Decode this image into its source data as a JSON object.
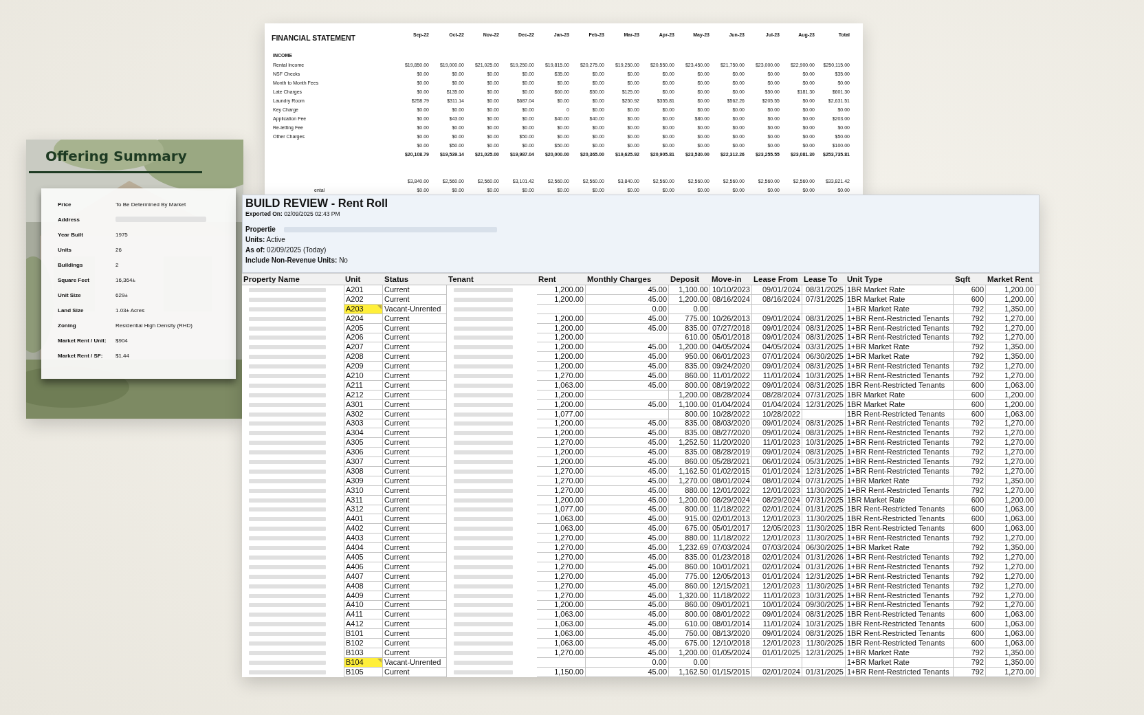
{
  "financial_statement": {
    "title": "FINANCIAL STATEMENT",
    "columns": [
      "Sep-22",
      "Oct-22",
      "Nov-22",
      "Dec-22",
      "Jan-23",
      "Feb-23",
      "Mar-23",
      "Apr-23",
      "May-23",
      "Jun-23",
      "Jul-23",
      "Aug-23",
      "Total"
    ],
    "rows": [
      {
        "kind": "section",
        "label": "INCOME"
      },
      {
        "kind": "item",
        "label": "Rental Income",
        "values": [
          "$19,850.00",
          "$19,000.00",
          "$21,025.00",
          "$19,250.00",
          "$19,815.00",
          "$20,275.00",
          "$19,250.00",
          "$20,550.00",
          "$23,450.00",
          "$21,750.00",
          "$23,000.00",
          "$22,900.00",
          "$250,115.00"
        ]
      },
      {
        "kind": "item",
        "label": "NSF Checks",
        "values": [
          "$0.00",
          "$0.00",
          "$0.00",
          "$0.00",
          "$35.00",
          "$0.00",
          "$0.00",
          "$0.00",
          "$0.00",
          "$0.00",
          "$0.00",
          "$0.00",
          "$35.00"
        ]
      },
      {
        "kind": "item",
        "label": "Month to Month Fees",
        "values": [
          "$0.00",
          "$0.00",
          "$0.00",
          "$0.00",
          "$0.00",
          "$0.00",
          "$0.00",
          "$0.00",
          "$0.00",
          "$0.00",
          "$0.00",
          "$0.00",
          "$0.00"
        ]
      },
      {
        "kind": "item",
        "label": "Late Charges",
        "values": [
          "$0.00",
          "$135.00",
          "$0.00",
          "$0.00",
          "$60.00",
          "$50.00",
          "$125.00",
          "$0.00",
          "$0.00",
          "$0.00",
          "$50.00",
          "$181.30",
          "$601.30"
        ]
      },
      {
        "kind": "item",
        "label": "Laundry Room",
        "values": [
          "$258.79",
          "$311.14",
          "$0.00",
          "$687.04",
          "$0.00",
          "$0.00",
          "$250.92",
          "$355.81",
          "$0.00",
          "$562.26",
          "$205.55",
          "$0.00",
          "$2,631.51"
        ]
      },
      {
        "kind": "item",
        "label": "Key Charge",
        "values": [
          "$0.00",
          "$0.00",
          "$0.00",
          "$0.00",
          "0",
          "$0.00",
          "$0.00",
          "$0.00",
          "$0.00",
          "$0.00",
          "$0.00",
          "$0.00",
          "$0.00"
        ]
      },
      {
        "kind": "item",
        "label": "Application Fee",
        "values": [
          "$0.00",
          "$43.00",
          "$0.00",
          "$0.00",
          "$40.00",
          "$40.00",
          "$0.00",
          "$0.00",
          "$80.00",
          "$0.00",
          "$0.00",
          "$0.00",
          "$203.00"
        ]
      },
      {
        "kind": "item",
        "label": "Re-letting Fee",
        "values": [
          "$0.00",
          "$0.00",
          "$0.00",
          "$0.00",
          "$0.00",
          "$0.00",
          "$0.00",
          "$0.00",
          "$0.00",
          "$0.00",
          "$0.00",
          "$0.00",
          "$0.00"
        ]
      },
      {
        "kind": "item",
        "label": "Other Charges",
        "values": [
          "$0.00",
          "$0.00",
          "$0.00",
          "$50.00",
          "$0.00",
          "$0.00",
          "$0.00",
          "$0.00",
          "$0.00",
          "$0.00",
          "$0.00",
          "$0.00",
          "$50.00"
        ]
      },
      {
        "kind": "item",
        "values": [
          "$0.00",
          "$50.00",
          "$0.00",
          "$0.00",
          "$50.00",
          "$0.00",
          "$0.00",
          "$0.00",
          "$0.00",
          "$0.00",
          "$0.00",
          "$0.00",
          "$100.00"
        ]
      },
      {
        "kind": "total",
        "values": [
          "$20,108.79",
          "$19,539.14",
          "$21,025.00",
          "$19,987.04",
          "$20,000.00",
          "$20,365.00",
          "$19,625.92",
          "$20,905.81",
          "$23,530.00",
          "$22,312.26",
          "$23,255.55",
          "$23,081.30",
          "$253,735.81"
        ]
      },
      {
        "kind": "spacer"
      },
      {
        "kind": "item",
        "values": [
          "$3,840.00",
          "$2,560.00",
          "$2,560.00",
          "$3,101.42",
          "$2,560.00",
          "$2,560.00",
          "$3,840.00",
          "$2,560.00",
          "$2,560.00",
          "$2,560.00",
          "$2,560.00",
          "$2,560.00",
          "$33,821.42"
        ]
      },
      {
        "kind": "item",
        "label": "ental",
        "label_cut": true,
        "values": [
          "$0.00",
          "$0.00",
          "$0.00",
          "$0.00",
          "$0.00",
          "$0.00",
          "$0.00",
          "$0.00",
          "$0.00",
          "$0.00",
          "$0.00",
          "$0.00",
          "$0.00"
        ]
      }
    ]
  },
  "offering_summary": {
    "title": "Offering Summary",
    "fields": [
      {
        "label": "Price",
        "value": "To Be Determined By Market"
      },
      {
        "label": "Address"
      },
      {
        "label": "Year Built",
        "value": "1975"
      },
      {
        "label": "Units",
        "value": "26"
      },
      {
        "label": "Buildings",
        "value": "2"
      },
      {
        "label": "Square Feet",
        "value": "16,364±"
      },
      {
        "label": "Unit Size",
        "value": "629±"
      },
      {
        "label": "Land Size",
        "value": "1.03± Acres"
      },
      {
        "label": "Zoning",
        "value": "Residential High Density (RHD)"
      },
      {
        "label": "Market Rent / Unit:",
        "value": "$904"
      },
      {
        "label": "Market Rent / SF:",
        "value": "$1.44"
      }
    ]
  },
  "rent_roll": {
    "title": "BUILD REVIEW - Rent Roll",
    "exported": "**Exported On:** 02/09/2025 02:43 PM",
    "property_label": "Propertie",
    "filters": [
      "**Units:** Active",
      "**As of:** 02/09/2025 (Today)",
      "**Include Non-Revenue Units:** No"
    ],
    "columns": [
      {
        "label": "Property Name",
        "kind": "redacted"
      },
      {
        "label": "Unit",
        "kind": "unit"
      },
      {
        "label": "Status",
        "kind": "text"
      },
      {
        "label": "Tenant",
        "kind": "redacted"
      },
      {
        "label": "Rent",
        "kind": "number"
      },
      {
        "label": "Monthly Charges",
        "kind": "number"
      },
      {
        "label": "Deposit",
        "kind": "number"
      },
      {
        "label": "Move-in",
        "kind": "number"
      },
      {
        "label": "Lease From",
        "kind": "number"
      },
      {
        "label": "Lease To",
        "kind": "number"
      },
      {
        "label": "Unit Type",
        "kind": "text"
      },
      {
        "label": "Sqft",
        "kind": "number"
      },
      {
        "label": "Market Rent",
        "kind": "number"
      }
    ],
    "rows": [
      {
        "highlighted": false,
        "cells": [
          null,
          "A201",
          "Current",
          null,
          "1,200.00",
          "45.00",
          "1,100.00",
          "10/10/2023",
          "09/01/2024",
          "08/31/2025",
          "1BR Market Rate",
          "600",
          "1,200.00"
        ]
      },
      {
        "highlighted": false,
        "cells": [
          null,
          "A202",
          "Current",
          null,
          "1,200.00",
          "45.00",
          "1,200.00",
          "08/16/2024",
          "08/16/2024",
          "07/31/2025",
          "1BR Market Rate",
          "600",
          "1,200.00"
        ]
      },
      {
        "highlighted": true,
        "cells": [
          null,
          "A203",
          "Vacant-Unrented",
          null,
          null,
          "0.00",
          "0.00",
          null,
          null,
          null,
          "1+BR Market Rate",
          "792",
          "1,350.00"
        ]
      },
      {
        "highlighted": false,
        "cells": [
          null,
          "A204",
          "Current",
          null,
          "1,200.00",
          "45.00",
          "775.00",
          "10/26/2013",
          "09/01/2024",
          "08/31/2025",
          "1+BR Rent-Restricted Tenants",
          "792",
          "1,270.00"
        ]
      },
      {
        "highlighted": false,
        "cells": [
          null,
          "A205",
          "Current",
          null,
          "1,200.00",
          "45.00",
          "835.00",
          "07/27/2018",
          "09/01/2024",
          "08/31/2025",
          "1+BR Rent-Restricted Tenants",
          "792",
          "1,270.00"
        ]
      },
      {
        "highlighted": false,
        "cells": [
          null,
          "A206",
          "Current",
          null,
          "1,200.00",
          null,
          "610.00",
          "05/01/2018",
          "09/01/2024",
          "08/31/2025",
          "1+BR Rent-Restricted Tenants",
          "792",
          "1,270.00"
        ]
      },
      {
        "highlighted": false,
        "cells": [
          null,
          "A207",
          "Current",
          null,
          "1,200.00",
          "45.00",
          "1,200.00",
          "04/05/2024",
          "04/05/2024",
          "03/31/2025",
          "1+BR Market Rate",
          "792",
          "1,350.00"
        ]
      },
      {
        "highlighted": false,
        "cells": [
          null,
          "A208",
          "Current",
          null,
          "1,200.00",
          "45.00",
          "950.00",
          "06/01/2023",
          "07/01/2024",
          "06/30/2025",
          "1+BR Market Rate",
          "792",
          "1,350.00"
        ]
      },
      {
        "highlighted": false,
        "cells": [
          null,
          "A209",
          "Current",
          null,
          "1,200.00",
          "45.00",
          "835.00",
          "09/24/2020",
          "09/01/2024",
          "08/31/2025",
          "1+BR Rent-Restricted Tenants",
          "792",
          "1,270.00"
        ]
      },
      {
        "highlighted": false,
        "cells": [
          null,
          "A210",
          "Current",
          null,
          "1,270.00",
          "45.00",
          "860.00",
          "11/01/2022",
          "11/01/2024",
          "10/31/2025",
          "1+BR Rent-Restricted Tenants",
          "792",
          "1,270.00"
        ]
      },
      {
        "highlighted": false,
        "cells": [
          null,
          "A211",
          "Current",
          null,
          "1,063.00",
          "45.00",
          "800.00",
          "08/19/2022",
          "09/01/2024",
          "08/31/2025",
          "1BR Rent-Restricted Tenants",
          "600",
          "1,063.00"
        ]
      },
      {
        "highlighted": false,
        "cells": [
          null,
          "A212",
          "Current",
          null,
          "1,200.00",
          null,
          "1,200.00",
          "08/28/2024",
          "08/28/2024",
          "07/31/2025",
          "1BR Market Rate",
          "600",
          "1,200.00"
        ]
      },
      {
        "highlighted": false,
        "cells": [
          null,
          "A301",
          "Current",
          null,
          "1,200.00",
          "45.00",
          "1,100.00",
          "01/04/2024",
          "01/04/2024",
          "12/31/2025",
          "1BR Market Rate",
          "600",
          "1,200.00"
        ]
      },
      {
        "highlighted": false,
        "cells": [
          null,
          "A302",
          "Current",
          null,
          "1,077.00",
          null,
          "800.00",
          "10/28/2022",
          "10/28/2022",
          null,
          "1BR Rent-Restricted Tenants",
          "600",
          "1,063.00"
        ]
      },
      {
        "highlighted": false,
        "cells": [
          null,
          "A303",
          "Current",
          null,
          "1,200.00",
          "45.00",
          "835.00",
          "08/03/2020",
          "09/01/2024",
          "08/31/2025",
          "1+BR Rent-Restricted Tenants",
          "792",
          "1,270.00"
        ]
      },
      {
        "highlighted": false,
        "cells": [
          null,
          "A304",
          "Current",
          null,
          "1,200.00",
          "45.00",
          "835.00",
          "08/27/2020",
          "09/01/2024",
          "08/31/2025",
          "1+BR Rent-Restricted Tenants",
          "792",
          "1,270.00"
        ]
      },
      {
        "highlighted": false,
        "cells": [
          null,
          "A305",
          "Current",
          null,
          "1,270.00",
          "45.00",
          "1,252.50",
          "11/20/2020",
          "11/01/2023",
          "10/31/2025",
          "1+BR Rent-Restricted Tenants",
          "792",
          "1,270.00"
        ]
      },
      {
        "highlighted": false,
        "cells": [
          null,
          "A306",
          "Current",
          null,
          "1,200.00",
          "45.00",
          "835.00",
          "08/28/2019",
          "09/01/2024",
          "08/31/2025",
          "1+BR Rent-Restricted Tenants",
          "792",
          "1,270.00"
        ]
      },
      {
        "highlighted": false,
        "cells": [
          null,
          "A307",
          "Current",
          null,
          "1,200.00",
          "45.00",
          "860.00",
          "05/28/2021",
          "06/01/2024",
          "05/31/2025",
          "1+BR Rent-Restricted Tenants",
          "792",
          "1,270.00"
        ]
      },
      {
        "highlighted": false,
        "cells": [
          null,
          "A308",
          "Current",
          null,
          "1,270.00",
          "45.00",
          "1,162.50",
          "01/02/2015",
          "01/01/2024",
          "12/31/2025",
          "1+BR Rent-Restricted Tenants",
          "792",
          "1,270.00"
        ]
      },
      {
        "highlighted": false,
        "cells": [
          null,
          "A309",
          "Current",
          null,
          "1,270.00",
          "45.00",
          "1,270.00",
          "08/01/2024",
          "08/01/2024",
          "07/31/2025",
          "1+BR Market Rate",
          "792",
          "1,350.00"
        ]
      },
      {
        "highlighted": false,
        "cells": [
          null,
          "A310",
          "Current",
          null,
          "1,270.00",
          "45.00",
          "880.00",
          "12/01/2022",
          "12/01/2023",
          "11/30/2025",
          "1+BR Rent-Restricted Tenants",
          "792",
          "1,270.00"
        ]
      },
      {
        "highlighted": false,
        "cells": [
          null,
          "A311",
          "Current",
          null,
          "1,200.00",
          "45.00",
          "1,200.00",
          "08/29/2024",
          "08/29/2024",
          "07/31/2025",
          "1BR Market Rate",
          "600",
          "1,200.00"
        ]
      },
      {
        "highlighted": false,
        "cells": [
          null,
          "A312",
          "Current",
          null,
          "1,077.00",
          "45.00",
          "800.00",
          "11/18/2022",
          "02/01/2024",
          "01/31/2025",
          "1BR Rent-Restricted Tenants",
          "600",
          "1,063.00"
        ]
      },
      {
        "highlighted": false,
        "cells": [
          null,
          "A401",
          "Current",
          null,
          "1,063.00",
          "45.00",
          "915.00",
          "02/01/2013",
          "12/01/2023",
          "11/30/2025",
          "1BR Rent-Restricted Tenants",
          "600",
          "1,063.00"
        ]
      },
      {
        "highlighted": false,
        "cells": [
          null,
          "A402",
          "Current",
          null,
          "1,063.00",
          "45.00",
          "675.00",
          "05/01/2017",
          "12/05/2023",
          "11/30/2025",
          "1BR Rent-Restricted Tenants",
          "600",
          "1,063.00"
        ]
      },
      {
        "highlighted": false,
        "cells": [
          null,
          "A403",
          "Current",
          null,
          "1,270.00",
          "45.00",
          "880.00",
          "11/18/2022",
          "12/01/2023",
          "11/30/2025",
          "1+BR Rent-Restricted Tenants",
          "792",
          "1,270.00"
        ]
      },
      {
        "highlighted": false,
        "cells": [
          null,
          "A404",
          "Current",
          null,
          "1,270.00",
          "45.00",
          "1,232.69",
          "07/03/2024",
          "07/03/2024",
          "06/30/2025",
          "1+BR Market Rate",
          "792",
          "1,350.00"
        ]
      },
      {
        "highlighted": false,
        "cells": [
          null,
          "A405",
          "Current",
          null,
          "1,270.00",
          "45.00",
          "835.00",
          "01/23/2018",
          "02/01/2024",
          "01/31/2026",
          "1+BR Rent-Restricted Tenants",
          "792",
          "1,270.00"
        ]
      },
      {
        "highlighted": false,
        "cells": [
          null,
          "A406",
          "Current",
          null,
          "1,270.00",
          "45.00",
          "860.00",
          "10/01/2021",
          "02/01/2024",
          "01/31/2026",
          "1+BR Rent-Restricted Tenants",
          "792",
          "1,270.00"
        ]
      },
      {
        "highlighted": false,
        "cells": [
          null,
          "A407",
          "Current",
          null,
          "1,270.00",
          "45.00",
          "775.00",
          "12/05/2013",
          "01/01/2024",
          "12/31/2025",
          "1+BR Rent-Restricted Tenants",
          "792",
          "1,270.00"
        ]
      },
      {
        "highlighted": false,
        "cells": [
          null,
          "A408",
          "Current",
          null,
          "1,270.00",
          "45.00",
          "860.00",
          "12/15/2021",
          "12/01/2023",
          "11/30/2025",
          "1+BR Rent-Restricted Tenants",
          "792",
          "1,270.00"
        ]
      },
      {
        "highlighted": false,
        "cells": [
          null,
          "A409",
          "Current",
          null,
          "1,270.00",
          "45.00",
          "1,320.00",
          "11/18/2022",
          "11/01/2023",
          "10/31/2025",
          "1+BR Rent-Restricted Tenants",
          "792",
          "1,270.00"
        ]
      },
      {
        "highlighted": false,
        "cells": [
          null,
          "A410",
          "Current",
          null,
          "1,200.00",
          "45.00",
          "860.00",
          "09/01/2021",
          "10/01/2024",
          "09/30/2025",
          "1+BR Rent-Restricted Tenants",
          "792",
          "1,270.00"
        ]
      },
      {
        "highlighted": false,
        "cells": [
          null,
          "A411",
          "Current",
          null,
          "1,063.00",
          "45.00",
          "800.00",
          "08/01/2022",
          "09/01/2024",
          "08/31/2025",
          "1BR Rent-Restricted Tenants",
          "600",
          "1,063.00"
        ]
      },
      {
        "highlighted": false,
        "cells": [
          null,
          "A412",
          "Current",
          null,
          "1,063.00",
          "45.00",
          "610.00",
          "08/01/2014",
          "11/01/2024",
          "10/31/2025",
          "1BR Rent-Restricted Tenants",
          "600",
          "1,063.00"
        ]
      },
      {
        "highlighted": false,
        "cells": [
          null,
          "B101",
          "Current",
          null,
          "1,063.00",
          "45.00",
          "750.00",
          "08/13/2020",
          "09/01/2024",
          "08/31/2025",
          "1BR Rent-Restricted Tenants",
          "600",
          "1,063.00"
        ]
      },
      {
        "highlighted": false,
        "cells": [
          null,
          "B102",
          "Current",
          null,
          "1,063.00",
          "45.00",
          "675.00",
          "12/10/2018",
          "12/01/2023",
          "11/30/2025",
          "1BR Rent-Restricted Tenants",
          "600",
          "1,063.00"
        ]
      },
      {
        "highlighted": false,
        "cells": [
          null,
          "B103",
          "Current",
          null,
          "1,270.00",
          "45.00",
          "1,200.00",
          "01/05/2024",
          "01/01/2025",
          "12/31/2025",
          "1+BR Market Rate",
          "792",
          "1,350.00"
        ]
      },
      {
        "highlighted": true,
        "cells": [
          null,
          "B104",
          "Vacant-Unrented",
          null,
          null,
          "0.00",
          "0.00",
          null,
          null,
          null,
          "1+BR Market Rate",
          "792",
          "1,350.00"
        ]
      },
      {
        "highlighted": false,
        "cells": [
          null,
          "B105",
          "Current",
          null,
          "1,150.00",
          "45.00",
          "1,162.50",
          "01/15/2015",
          "02/01/2024",
          "01/31/2025",
          "1+BR Rent-Restricted Tenants",
          "792",
          "1,270.00"
        ]
      }
    ]
  }
}
